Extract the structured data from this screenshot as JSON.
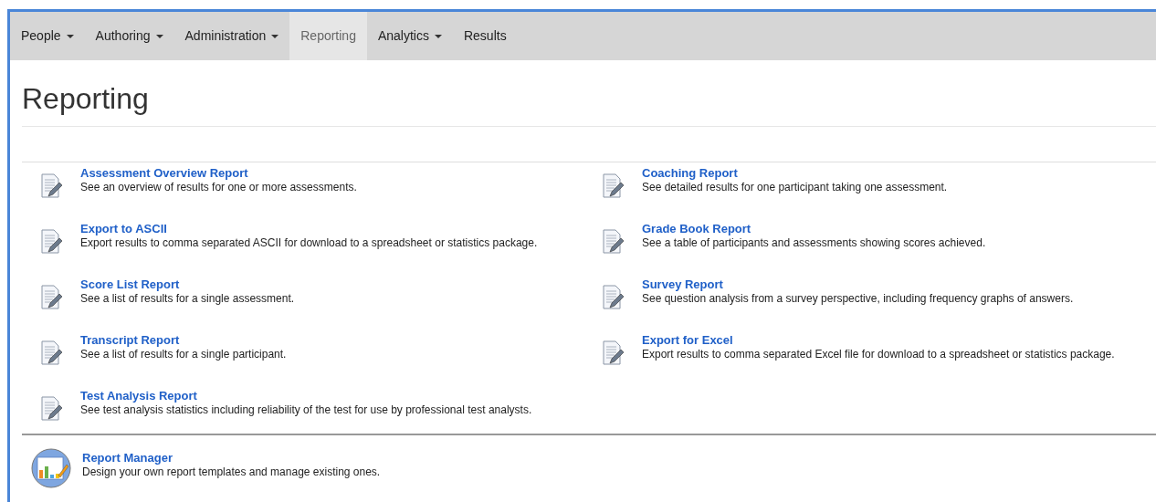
{
  "nav": [
    {
      "label": "People",
      "dropdown": true,
      "selected": false
    },
    {
      "label": "Authoring",
      "dropdown": true,
      "selected": false
    },
    {
      "label": "Administration",
      "dropdown": true,
      "selected": false
    },
    {
      "label": "Reporting",
      "dropdown": false,
      "selected": true
    },
    {
      "label": "Analytics",
      "dropdown": true,
      "selected": false
    },
    {
      "label": "Results",
      "dropdown": false,
      "selected": false
    }
  ],
  "title": "Reporting",
  "reports": [
    {
      "title": "Assessment Overview Report",
      "description": "See an overview of results for one or more assessments."
    },
    {
      "title": "Coaching Report",
      "description": "See detailed results for one participant taking one assessment."
    },
    {
      "title": "Export to ASCII",
      "description": "Export results to comma separated ASCII for download to a spreadsheet or statistics package."
    },
    {
      "title": "Grade Book Report",
      "description": "See a table of participants and assessments showing scores achieved."
    },
    {
      "title": "Score List Report",
      "description": "See a list of results for a single assessment."
    },
    {
      "title": "Survey Report",
      "description": "See question analysis from a survey perspective, including frequency graphs of answers."
    },
    {
      "title": "Transcript Report",
      "description": "See a list of results for a single participant."
    },
    {
      "title": "Export for Excel",
      "description": "Export results to comma separated Excel file for download to a spreadsheet or statistics package."
    },
    {
      "title": "Test Analysis Report",
      "description": "See test analysis statistics including reliability of the test for use by professional test analysts."
    }
  ],
  "manager": {
    "title": "Report Manager",
    "description": "Design your own report templates and manage existing ones."
  }
}
